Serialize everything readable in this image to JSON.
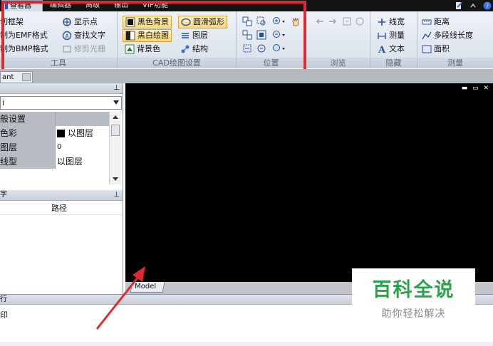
{
  "menubar": {
    "tabs": [
      {
        "label": "查看器",
        "active": true
      },
      {
        "label": "编辑器"
      },
      {
        "label": "高级"
      },
      {
        "label": "输出"
      },
      {
        "label": "VIP功能"
      }
    ]
  },
  "ribbon": {
    "tools": {
      "label": "工具",
      "items": [
        "切框架",
        "制为EMF格式",
        "制为BMP格式"
      ],
      "items2": [
        "显示点",
        "查找文字",
        "修剪光栅"
      ]
    },
    "cad": {
      "label": "CAD绘图设置",
      "col1": [
        "黑色背景",
        "黑白绘图",
        "背景色"
      ],
      "col2": [
        "圆滑弧形",
        "图层",
        "结构"
      ]
    },
    "position": {
      "label": "位置"
    },
    "browse": {
      "label": "浏览"
    },
    "hide": {
      "label": "隐藏",
      "items": [
        "线宽",
        "测量",
        "文本"
      ]
    },
    "measure": {
      "label": "测量",
      "items": [
        "距离",
        "多段线长度",
        "面积"
      ]
    }
  },
  "doc_tab": {
    "label": "ant"
  },
  "properties": {
    "rows": [
      {
        "name": "般设置",
        "value": ""
      },
      {
        "name": "色彩",
        "value": "以图层"
      },
      {
        "name": "图层",
        "value": "0"
      },
      {
        "name": "线型",
        "value": "以图层"
      }
    ],
    "combo_value": "i"
  },
  "path_panel": {
    "title_left": "字",
    "column": "路径"
  },
  "canvas": {
    "model_tab": "Model"
  },
  "output": {
    "title": "行",
    "line": "印"
  },
  "watermark": {
    "brand": "百科全说",
    "slogan": "助你轻松解决"
  },
  "colors": {
    "highlight_red": "#e0282f",
    "brand_green": "#2ca34a",
    "canvas": "#000000"
  }
}
